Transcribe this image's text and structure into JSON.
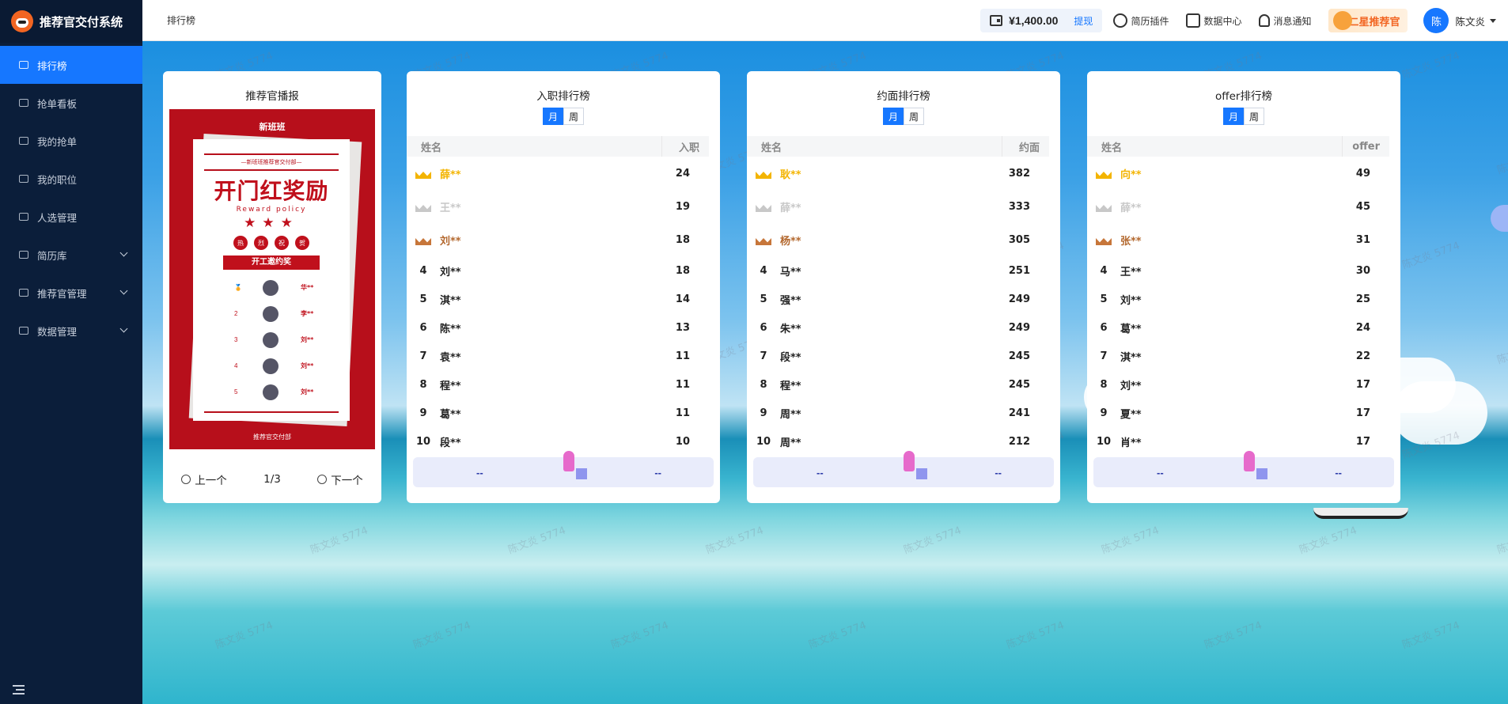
{
  "app": {
    "title": "推荐官交付系统"
  },
  "sidebar": {
    "items": [
      {
        "label": "排行榜",
        "active": true
      },
      {
        "label": "抢单看板"
      },
      {
        "label": "我的抢单"
      },
      {
        "label": "我的职位"
      },
      {
        "label": "人选管理"
      },
      {
        "label": "简历库",
        "expandable": true
      },
      {
        "label": "推荐官管理",
        "expandable": true
      },
      {
        "label": "数据管理",
        "expandable": true
      }
    ]
  },
  "header": {
    "breadcrumb": "排行榜",
    "wallet_amount": "¥1,400.00",
    "withdraw": "提现",
    "links": [
      "简历插件",
      "数据中心",
      "消息通知"
    ],
    "level_badge": "二星推荐官",
    "avatar": "陈",
    "username": "陈文炎"
  },
  "watermark": "陈文炎 5774",
  "poster": {
    "title": "推荐官播报",
    "brand": "新班班",
    "subtitle": "—新班班推荐官交付部—",
    "headline": "开门红奖励",
    "headline_en": "Reward policy",
    "stars": "★★★",
    "badges": [
      "热",
      "烈",
      "祝",
      "贺"
    ],
    "ribbon": "开工邀约奖",
    "rows": [
      {
        "rank": "",
        "name": "华**"
      },
      {
        "rank": "2",
        "name": "李**"
      },
      {
        "rank": "3",
        "name": "刘**"
      },
      {
        "rank": "4",
        "name": "刘**"
      },
      {
        "rank": "5",
        "name": "刘**"
      }
    ],
    "footer": "推荐官交付部",
    "prev": "上一个",
    "page": "1/3",
    "next": "下一个"
  },
  "boards": [
    {
      "title": "入职排行榜",
      "toggle": [
        "月",
        "周"
      ],
      "col_name": "姓名",
      "col_value": "入职",
      "rows": [
        {
          "rank": 1,
          "name": "薛**",
          "value": "24"
        },
        {
          "rank": 2,
          "name": "王**",
          "value": "19"
        },
        {
          "rank": 3,
          "name": "刘**",
          "value": "18"
        },
        {
          "rank": 4,
          "name": "刘**",
          "value": "18"
        },
        {
          "rank": 5,
          "name": "淇**",
          "value": "14"
        },
        {
          "rank": 6,
          "name": "陈**",
          "value": "13"
        },
        {
          "rank": 7,
          "name": "袁**",
          "value": "11"
        },
        {
          "rank": 8,
          "name": "程**",
          "value": "11"
        },
        {
          "rank": 9,
          "name": "葛**",
          "value": "11"
        },
        {
          "rank": 10,
          "name": "段**",
          "value": "10"
        }
      ],
      "me": {
        "left": "--",
        "right": "--"
      }
    },
    {
      "title": "约面排行榜",
      "toggle": [
        "月",
        "周"
      ],
      "col_name": "姓名",
      "col_value": "约面",
      "rows": [
        {
          "rank": 1,
          "name": "耿**",
          "value": "382"
        },
        {
          "rank": 2,
          "name": "薛**",
          "value": "333"
        },
        {
          "rank": 3,
          "name": "杨**",
          "value": "305"
        },
        {
          "rank": 4,
          "name": "马**",
          "value": "251"
        },
        {
          "rank": 5,
          "name": "强**",
          "value": "249"
        },
        {
          "rank": 6,
          "name": "朱**",
          "value": "249"
        },
        {
          "rank": 7,
          "name": "段**",
          "value": "245"
        },
        {
          "rank": 8,
          "name": "程**",
          "value": "245"
        },
        {
          "rank": 9,
          "name": "周**",
          "value": "241"
        },
        {
          "rank": 10,
          "name": "周**",
          "value": "212"
        }
      ],
      "me": {
        "left": "--",
        "right": "--"
      }
    },
    {
      "title": "offer排行榜",
      "toggle": [
        "月",
        "周"
      ],
      "col_name": "姓名",
      "col_value": "offer",
      "rows": [
        {
          "rank": 1,
          "name": "向**",
          "value": "49"
        },
        {
          "rank": 2,
          "name": "薛**",
          "value": "45"
        },
        {
          "rank": 3,
          "name": "张**",
          "value": "31"
        },
        {
          "rank": 4,
          "name": "王**",
          "value": "30"
        },
        {
          "rank": 5,
          "name": "刘**",
          "value": "25"
        },
        {
          "rank": 6,
          "name": "葛**",
          "value": "24"
        },
        {
          "rank": 7,
          "name": "淇**",
          "value": "22"
        },
        {
          "rank": 8,
          "name": "刘**",
          "value": "17"
        },
        {
          "rank": 9,
          "name": "夏**",
          "value": "17"
        },
        {
          "rank": 10,
          "name": "肖**",
          "value": "17"
        }
      ],
      "me": {
        "left": "--",
        "right": "--"
      }
    }
  ]
}
